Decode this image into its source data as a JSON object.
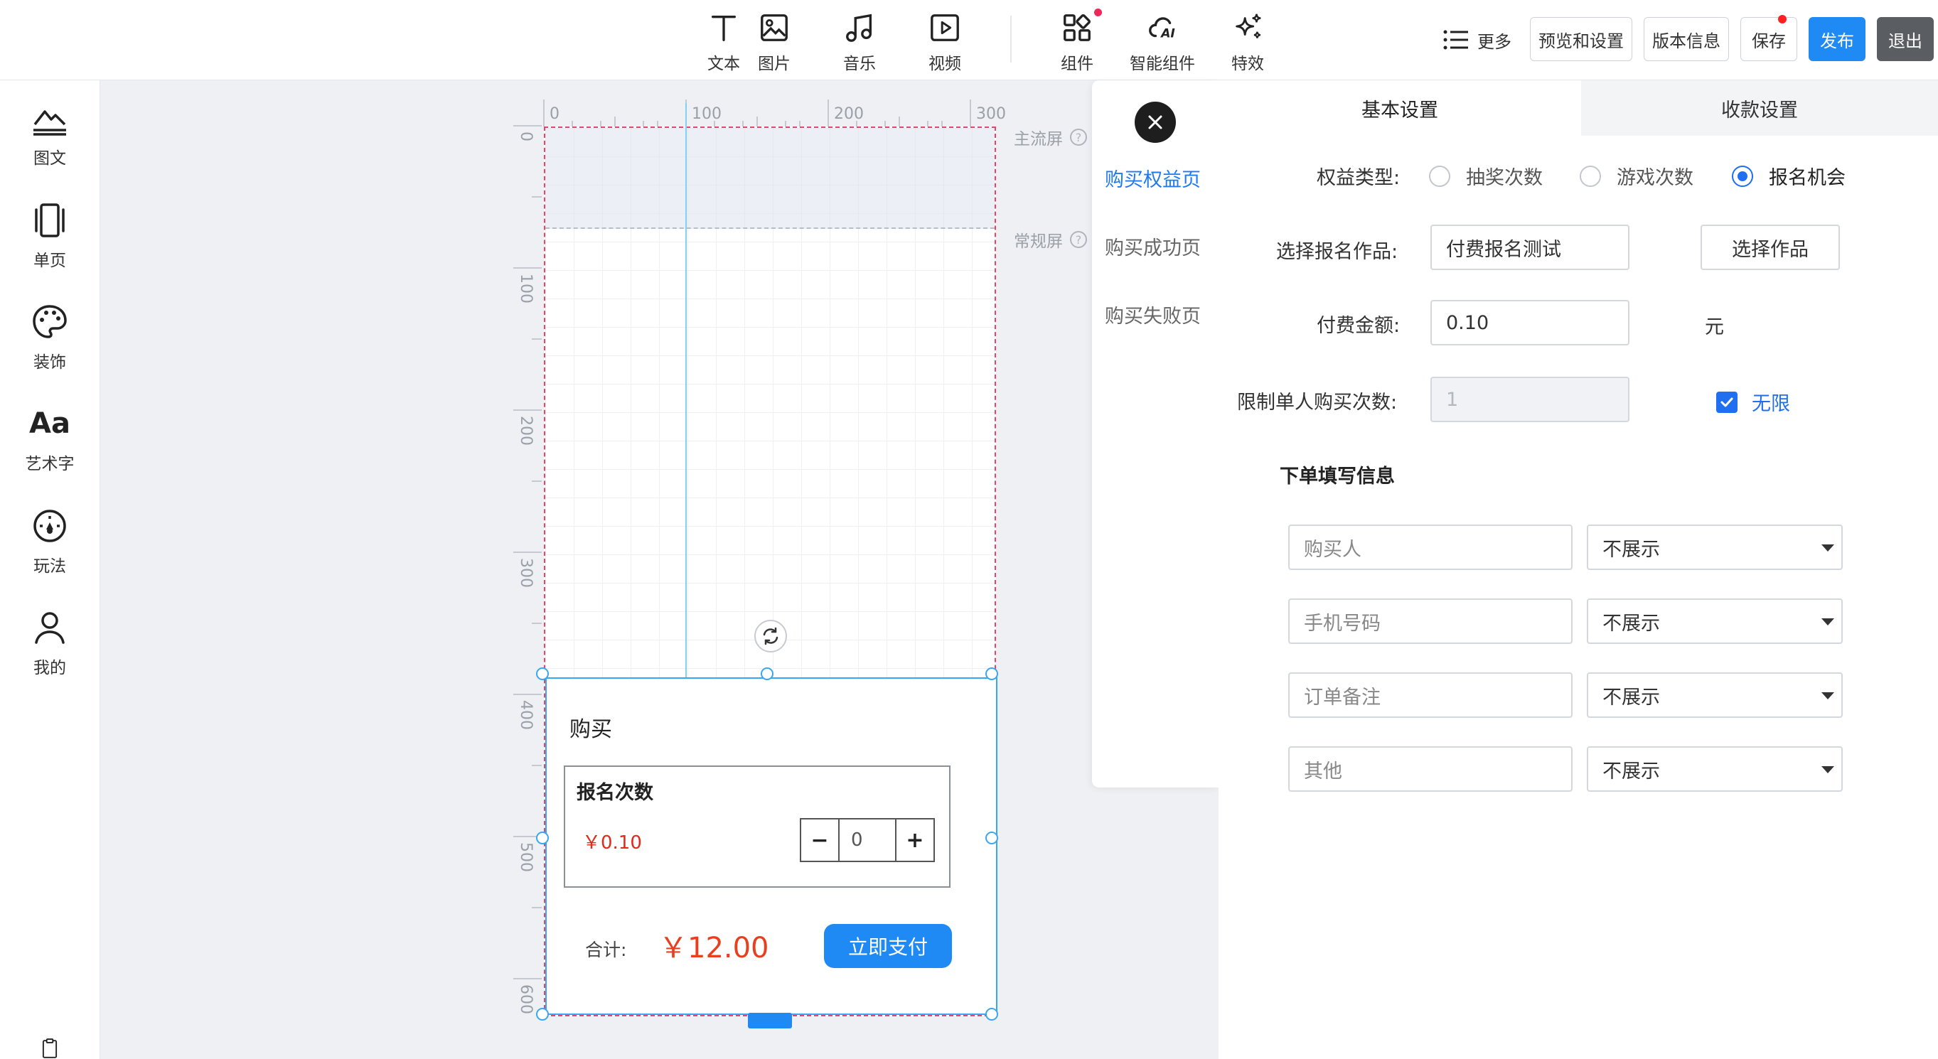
{
  "toolbar": {
    "items": [
      {
        "label": "文本",
        "icon": "text-icon"
      },
      {
        "label": "图片",
        "icon": "image-icon"
      },
      {
        "label": "音乐",
        "icon": "music-icon"
      },
      {
        "label": "视频",
        "icon": "video-icon"
      },
      {
        "label": "组件",
        "icon": "components-icon",
        "badge": true
      },
      {
        "label": "智能组件",
        "icon": "ai-cloud-icon"
      },
      {
        "label": "特效",
        "icon": "sparkle-icon"
      }
    ],
    "more_label": "更多",
    "buttons": {
      "preview": "预览和设置",
      "version": "版本信息",
      "save": "保存",
      "publish": "发布",
      "exit": "退出"
    }
  },
  "sidebar": {
    "items": [
      {
        "label": "图文",
        "icon": "image-text-icon"
      },
      {
        "label": "单页",
        "icon": "single-page-icon"
      },
      {
        "label": "装饰",
        "icon": "palette-icon"
      },
      {
        "label": "艺术字",
        "icon": "art-text-icon",
        "glyph": "Aa"
      },
      {
        "label": "玩法",
        "icon": "gameplay-icon"
      },
      {
        "label": "我的",
        "icon": "user-icon"
      }
    ]
  },
  "canvas": {
    "ruler_h": [
      "0",
      "100",
      "200",
      "300"
    ],
    "ruler_v": [
      "0",
      "100",
      "200",
      "300",
      "400",
      "500",
      "600"
    ],
    "main_screen_label": "主流屏",
    "normal_screen_label": "常规屏",
    "help_glyph": "?",
    "buy_component": {
      "title": "购买",
      "sku_name": "报名次数",
      "sku_price": "￥0.10",
      "stepper_minus": "−",
      "stepper_value": "0",
      "stepper_plus": "+",
      "total_label": "合计:",
      "total_value": "￥12.00",
      "pay_button": "立即支付"
    }
  },
  "page_panel": {
    "items": [
      {
        "label": "购买权益页",
        "active": true
      },
      {
        "label": "购买成功页",
        "active": false
      },
      {
        "label": "购买失败页",
        "active": false
      }
    ]
  },
  "settings": {
    "tabs": {
      "basic": "基本设置",
      "payment": "收款设置"
    },
    "benefit_type": {
      "label": "权益类型:",
      "options": [
        "抽奖次数",
        "游戏次数",
        "报名机会"
      ],
      "selected": "报名机会"
    },
    "select_work": {
      "label": "选择报名作品:",
      "value": "付费报名测试",
      "button": "选择作品"
    },
    "amount": {
      "label": "付费金额:",
      "value": "0.10",
      "unit": "元"
    },
    "limit": {
      "label": "限制单人购买次数:",
      "value": "1",
      "unlimited_label": "无限",
      "unlimited_checked": true
    },
    "order_info": {
      "title": "下单填写信息",
      "rows": [
        {
          "field": "购买人",
          "display": "不展示"
        },
        {
          "field": "手机号码",
          "display": "不展示"
        },
        {
          "field": "订单备注",
          "display": "不展示"
        },
        {
          "field": "其他",
          "display": "不展示"
        }
      ]
    }
  },
  "colors": {
    "accent": "#1f8af3",
    "price": "#e02a1b",
    "selection": "#39a7f0"
  }
}
